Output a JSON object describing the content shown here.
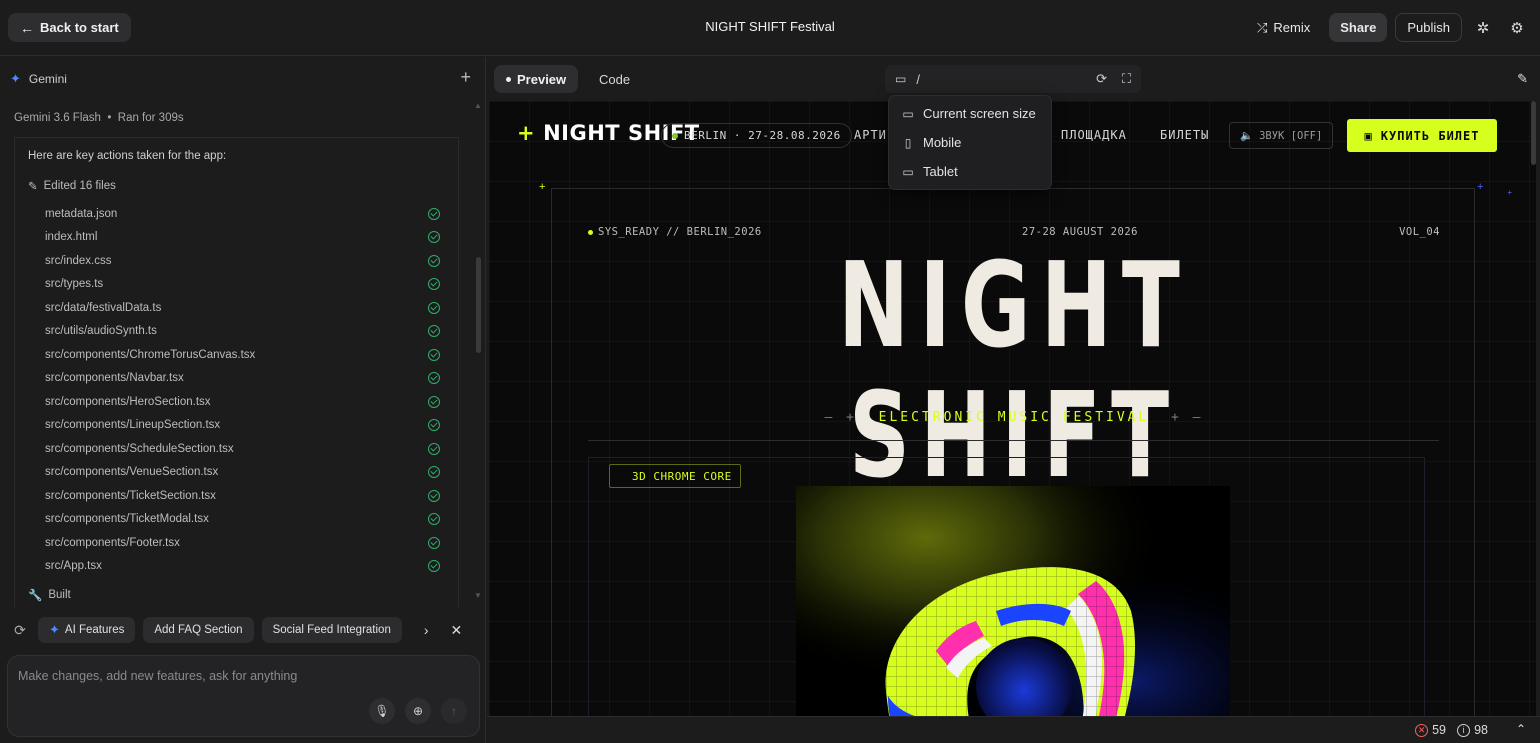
{
  "topbar": {
    "back_label": "Back to start",
    "title": "NIGHT SHIFT Festival",
    "remix_label": "Remix",
    "share_label": "Share",
    "publish_label": "Publish"
  },
  "left": {
    "agent_name": "Gemini",
    "model": "Gemini 3.6 Flash",
    "run_status": "Ran for 309s",
    "actions_intro": "Here are key actions taken for the app:",
    "edited_label": "Edited 16 files",
    "files": [
      "metadata.json",
      "index.html",
      "src/index.css",
      "src/types.ts",
      "src/data/festivalData.ts",
      "src/utils/audioSynth.ts",
      "src/components/ChromeTorusCanvas.tsx",
      "src/components/Navbar.tsx",
      "src/components/HeroSection.tsx",
      "src/components/LineupSection.tsx",
      "src/components/ScheduleSection.tsx",
      "src/components/VenueSection.tsx",
      "src/components/TicketSection.tsx",
      "src/components/TicketModal.tsx",
      "src/components/Footer.tsx",
      "src/App.tsx"
    ],
    "built_label": "Built",
    "suggestions": [
      "AI Features",
      "Add FAQ Section",
      "Social Feed Integration"
    ],
    "prompt_placeholder": "Make changes, add new features, ask for anything"
  },
  "preview": {
    "tab_preview": "Preview",
    "tab_code": "Code",
    "url_path": "/",
    "device_menu": [
      "Current screen size",
      "Mobile",
      "Tablet"
    ],
    "errors": "59",
    "infos": "98"
  },
  "site": {
    "logo": "NIGHT SHIFT",
    "location_pill": "BERLIN · 27-28.08.2026",
    "nav_links": [
      "АРТИ",
      "ПЛОЩАДКА",
      "БИЛЕТЫ"
    ],
    "sound_label": "ЗВУК [OFF]",
    "buy_label": "КУПИТЬ БИЛЕТ",
    "hud_left": "SYS_READY // BERLIN_2026",
    "hud_mid": "27-28 AUGUST 2026",
    "hud_right": "VOL_04",
    "hero_title": "NIGHT SHIFT",
    "subtitle": "ELECTRONIC MUSIC FESTIVAL",
    "core_badge": "3D CHROME CORE"
  },
  "colors": {
    "accent": "#d7ff1e",
    "background": "#0a0a0b",
    "ui_bg": "#1c1c1d",
    "error": "#ff5c5c",
    "success": "#2fae6b",
    "gemini_blue": "#4a8cff"
  }
}
